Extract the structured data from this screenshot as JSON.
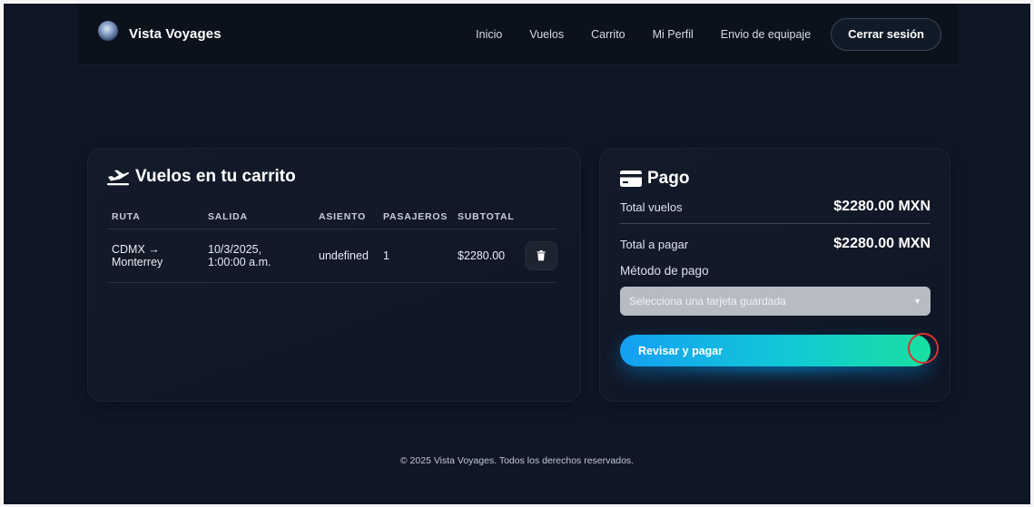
{
  "header": {
    "brand": "Vista Voyages",
    "nav": [
      "Inicio",
      "Vuelos",
      "Carrito",
      "Mi Perfil",
      "Envio de equipaje"
    ],
    "logout_label": "Cerrar sesión"
  },
  "cart": {
    "title": "Vuelos en tu carrito",
    "columns": [
      "RUTA",
      "SALIDA",
      "ASIENTO",
      "PASAJEROS",
      "SUBTOTAL"
    ],
    "rows": [
      {
        "route_line1": "CDMX →",
        "route_line2": "Monterrey",
        "departure_line1": "10/3/2025,",
        "departure_line2": "1:00:00 a.m.",
        "seat": "undefined",
        "passengers": "1",
        "subtotal": "$2280.00"
      }
    ]
  },
  "payment": {
    "title": "Pago",
    "total_flights_label": "Total vuelos",
    "total_flights_value": "$2280.00 MXN",
    "total_due_label": "Total a pagar",
    "total_due_value": "$2280.00 MXN",
    "method_label": "Método de pago",
    "select_placeholder": "Selecciona una tarjeta guardada",
    "pay_button_label": "Revisar y pagar"
  },
  "footer": {
    "text": "© 2025 Vista Voyages. Todos los derechos reservados."
  },
  "colors": {
    "background": "#0f1726",
    "accent_start": "#14a0f2",
    "accent_end": "#18e0a0",
    "cursor_marker": "#d8322f"
  },
  "icons": {
    "logo": "globe-logo-icon",
    "cart_title": "airplane-departure-icon",
    "payment_title": "credit-card-icon",
    "row_action": "trash-icon"
  }
}
